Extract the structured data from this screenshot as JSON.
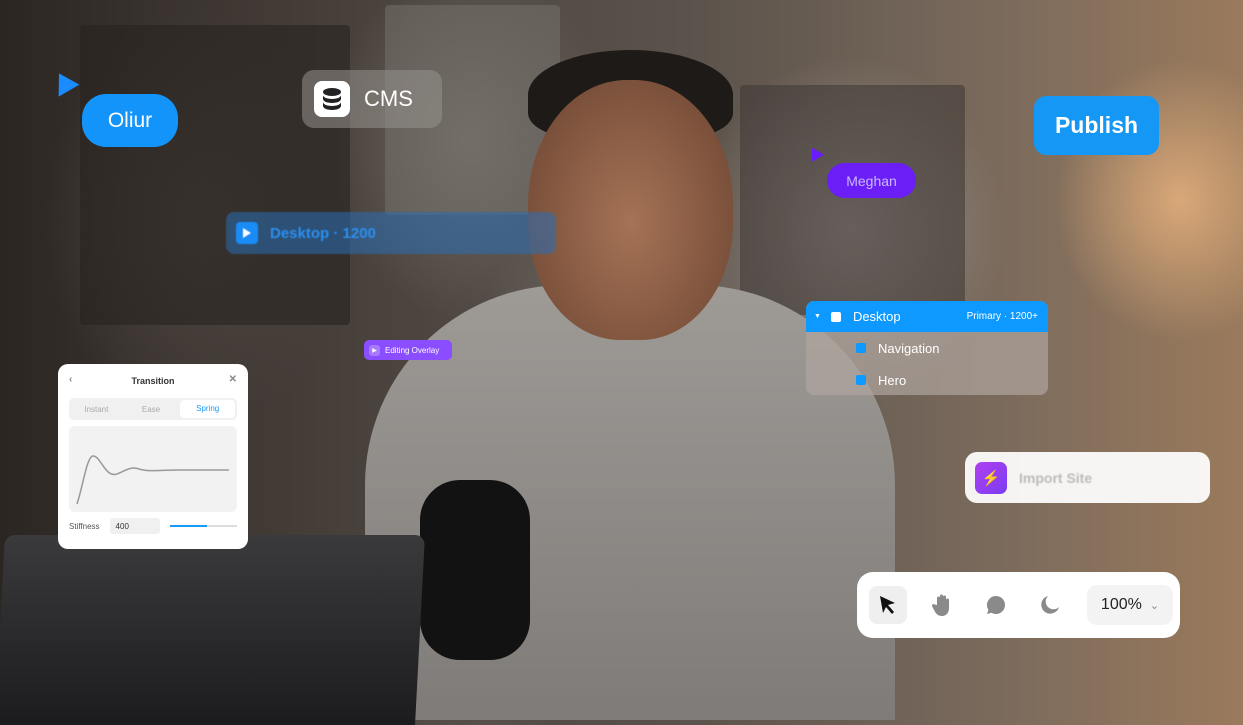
{
  "collaborators": [
    {
      "name": "Oliur",
      "color": "#1394fa"
    },
    {
      "name": "Meghan",
      "color": "#6b1ef5"
    }
  ],
  "cms": {
    "label": "CMS",
    "icon": "database-icon"
  },
  "publish": {
    "label": "Publish",
    "color": "#1497f5"
  },
  "breakpoint_bar": {
    "label": "Desktop · 1200",
    "icon": "play-icon"
  },
  "editing_overlay": {
    "label": "Editing Overlay",
    "icon": "play-icon",
    "color": "#8a4dff"
  },
  "layers": {
    "header": {
      "label": "Desktop",
      "meta": "Primary · 1200+",
      "color": "#0d99ff"
    },
    "items": [
      {
        "label": "Navigation"
      },
      {
        "label": "Hero"
      }
    ]
  },
  "transition_panel": {
    "title": "Transition",
    "tabs": [
      {
        "label": "Instant",
        "active": false
      },
      {
        "label": "Ease",
        "active": false
      },
      {
        "label": "Spring",
        "active": true
      }
    ],
    "stiffness": {
      "label": "Stiffness",
      "value": "400",
      "slider_fraction": 0.55
    }
  },
  "import_site": {
    "label": "Import Site",
    "icon": "lightning-icon"
  },
  "toolbar": {
    "tools": [
      {
        "name": "select",
        "icon": "cursor-arrow-icon",
        "active": true
      },
      {
        "name": "hand",
        "icon": "hand-icon",
        "active": false
      },
      {
        "name": "comment",
        "icon": "comment-icon",
        "active": false
      },
      {
        "name": "dark-mode",
        "icon": "moon-icon",
        "active": false
      }
    ],
    "zoom_label": "100%"
  }
}
